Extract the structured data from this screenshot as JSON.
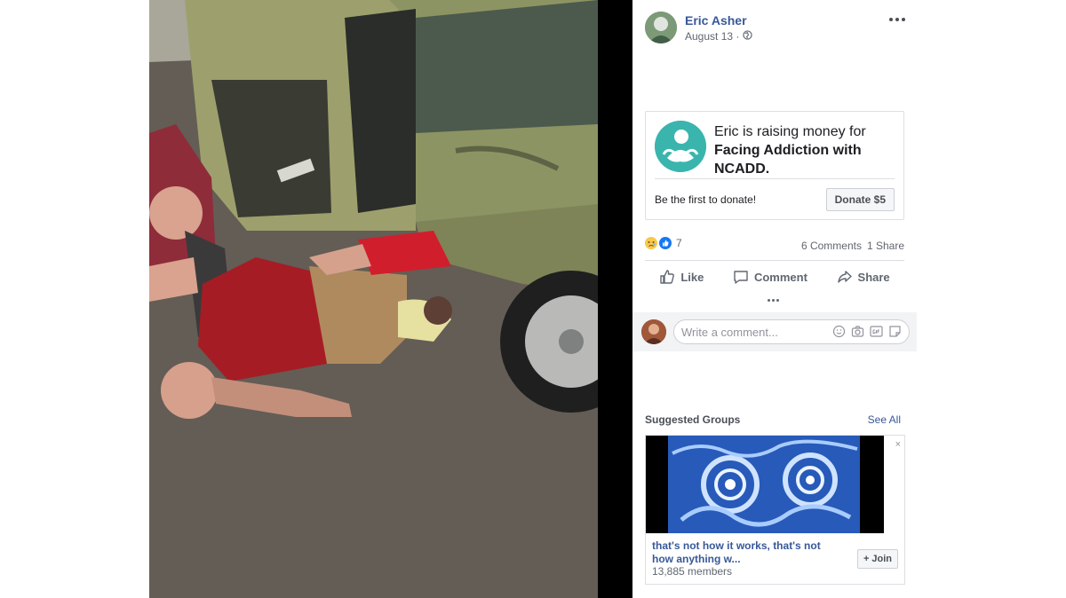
{
  "post": {
    "author": "Eric Asher",
    "date": "August 13 ·",
    "privacy_icon": "globe-icon"
  },
  "fundraiser": {
    "intro": "Eric is raising money for",
    "cause": "Facing Addiction with NCADD.",
    "first_donate": "Be the first to donate!",
    "donate_label": "Donate $5"
  },
  "stats": {
    "reaction_count": "7",
    "comments": "6 Comments",
    "shares": "1 Share"
  },
  "actions": {
    "like": "Like",
    "comment": "Comment",
    "share": "Share"
  },
  "comment_box": {
    "placeholder": "Write a comment..."
  },
  "suggested": {
    "title": "Suggested Groups",
    "see_all": "See All",
    "group_name": "that's not how it works, that's not how anything w...",
    "members": "13,885 members",
    "join_label": "Join",
    "close_label": "×"
  },
  "colors": {
    "link": "#385898",
    "fundraiser_logo": "#3ab5ae",
    "like_blue": "#1877f2",
    "sad_yellow": "#f7c94b"
  }
}
